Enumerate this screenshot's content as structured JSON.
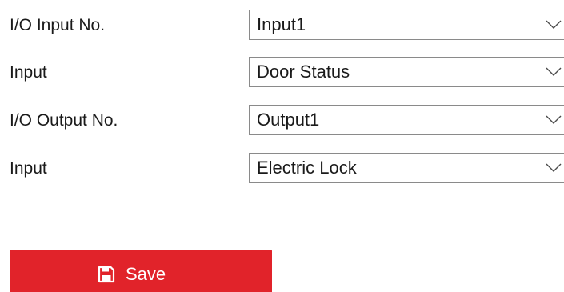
{
  "form": {
    "rows": [
      {
        "label": "I/O Input No.",
        "value": "Input1"
      },
      {
        "label": "Input",
        "value": "Door Status"
      },
      {
        "label": "I/O Output No.",
        "value": "Output1"
      },
      {
        "label": "Input",
        "value": "Electric Lock"
      }
    ]
  },
  "save_button": {
    "label": "Save",
    "icon": "floppy-disk-icon"
  },
  "colors": {
    "accent": "#e1232a",
    "border": "#8a8a8a",
    "text": "#1a1a1a"
  }
}
